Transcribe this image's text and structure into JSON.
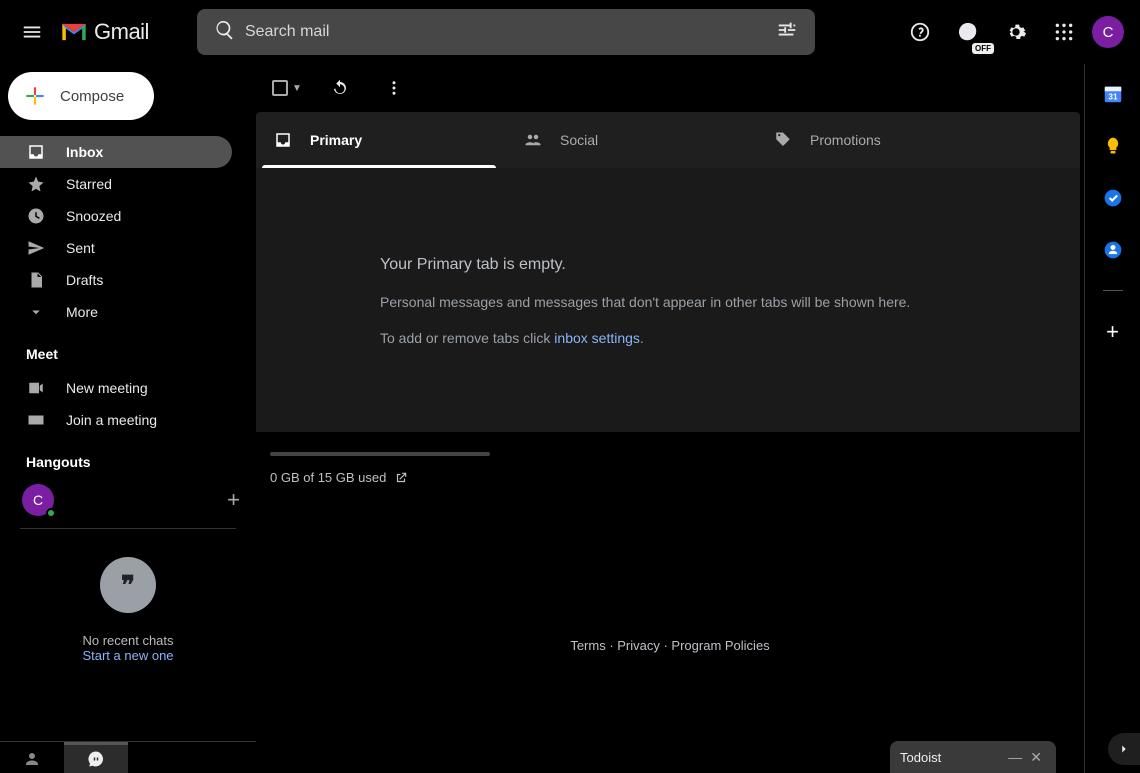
{
  "header": {
    "product": "Gmail",
    "search_placeholder": "Search mail",
    "online_badge": "OFF",
    "avatar_initial": "C"
  },
  "sidebar": {
    "compose_label": "Compose",
    "items": [
      {
        "label": "Inbox",
        "icon": "inbox",
        "active": true
      },
      {
        "label": "Starred",
        "icon": "star",
        "active": false
      },
      {
        "label": "Snoozed",
        "icon": "clock",
        "active": false
      },
      {
        "label": "Sent",
        "icon": "send",
        "active": false
      },
      {
        "label": "Drafts",
        "icon": "draft",
        "active": false
      },
      {
        "label": "More",
        "icon": "more",
        "active": false
      }
    ],
    "meet_title": "Meet",
    "meet_items": [
      {
        "label": "New meeting",
        "icon": "video"
      },
      {
        "label": "Join a meeting",
        "icon": "keyboard"
      }
    ],
    "hangouts_title": "Hangouts",
    "hangouts_initial": "C",
    "hangouts_quote": "❞",
    "no_recent": "No recent chats",
    "start_new": "Start a new one"
  },
  "tabs": [
    {
      "label": "Primary",
      "icon": "inbox",
      "active": true
    },
    {
      "label": "Social",
      "icon": "people",
      "active": false
    },
    {
      "label": "Promotions",
      "icon": "tag",
      "active": false
    }
  ],
  "empty": {
    "heading": "Your Primary tab is empty.",
    "line1": "Personal messages and messages that don't appear in other tabs will be shown here.",
    "line2_pre": "To add or remove tabs click ",
    "line2_link": "inbox settings",
    "line2_post": "."
  },
  "footer": {
    "usage": "0 GB of 15 GB used",
    "links": "Terms · Privacy · Program Policies"
  },
  "popup": {
    "title": "Todoist"
  }
}
